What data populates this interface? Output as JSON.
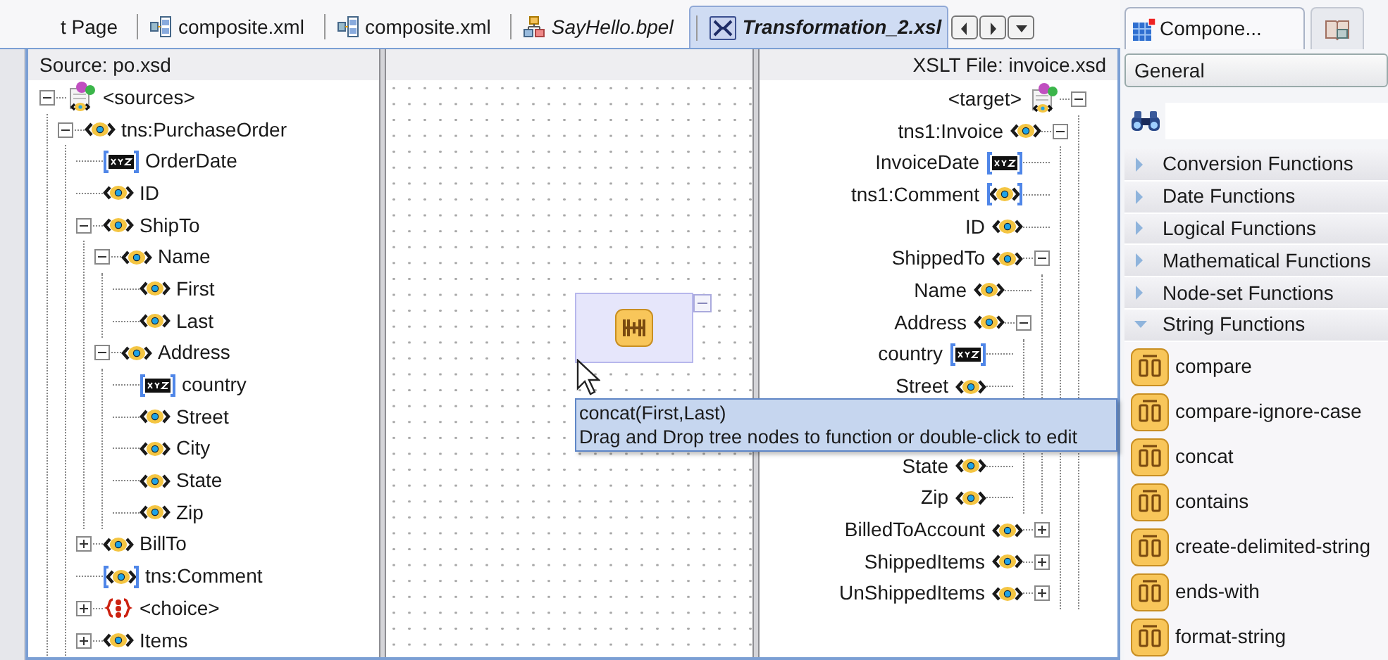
{
  "editor_tabs": [
    {
      "label": "t Page",
      "kind": "page",
      "italic": false,
      "selected": false
    },
    {
      "label": "composite.xml",
      "kind": "composite",
      "italic": false,
      "selected": false
    },
    {
      "label": "composite.xml",
      "kind": "composite",
      "italic": false,
      "selected": false
    },
    {
      "label": "SayHello.bpel",
      "kind": "bpel",
      "italic": true,
      "selected": false
    },
    {
      "label": "Transformation_2.xsl",
      "kind": "xsl",
      "italic": true,
      "selected": true
    }
  ],
  "source": {
    "title": "Source: po.xsd",
    "tree": [
      {
        "label": "<sources>",
        "kind": "root",
        "bracketed": false,
        "expanded": true,
        "children": [
          {
            "label": "tns:PurchaseOrder",
            "kind": "element",
            "bracketed": false,
            "expanded": true,
            "children": [
              {
                "label": "OrderDate",
                "kind": "text",
                "bracketed": true
              },
              {
                "label": "ID",
                "kind": "element",
                "bracketed": false
              },
              {
                "label": "ShipTo",
                "kind": "element",
                "bracketed": false,
                "expanded": true,
                "children": [
                  {
                    "label": "Name",
                    "kind": "element",
                    "bracketed": false,
                    "expanded": true,
                    "children": [
                      {
                        "label": "First",
                        "kind": "element",
                        "bracketed": false
                      },
                      {
                        "label": "Last",
                        "kind": "element",
                        "bracketed": false
                      }
                    ]
                  },
                  {
                    "label": "Address",
                    "kind": "element",
                    "bracketed": false,
                    "expanded": true,
                    "children": [
                      {
                        "label": "country",
                        "kind": "text",
                        "bracketed": true
                      },
                      {
                        "label": "Street",
                        "kind": "element",
                        "bracketed": false
                      },
                      {
                        "label": "City",
                        "kind": "element",
                        "bracketed": false
                      },
                      {
                        "label": "State",
                        "kind": "element",
                        "bracketed": false
                      },
                      {
                        "label": "Zip",
                        "kind": "element",
                        "bracketed": false
                      }
                    ]
                  }
                ]
              },
              {
                "label": "BillTo",
                "kind": "element",
                "bracketed": false,
                "expanded": false
              },
              {
                "label": "tns:Comment",
                "kind": "element",
                "bracketed": true
              },
              {
                "label": "<choice>",
                "kind": "choice",
                "bracketed": false,
                "expanded": false
              },
              {
                "label": "Items",
                "kind": "element",
                "bracketed": false,
                "expanded": false
              }
            ]
          }
        ]
      }
    ]
  },
  "target": {
    "title": "XSLT File: invoice.xsd",
    "tree": [
      {
        "label": "<target>",
        "kind": "root",
        "bracketed": false,
        "expanded": true,
        "children": [
          {
            "label": "tns1:Invoice",
            "kind": "element",
            "bracketed": false,
            "expanded": true,
            "children": [
              {
                "label": "InvoiceDate",
                "kind": "text",
                "bracketed": true
              },
              {
                "label": "tns1:Comment",
                "kind": "element",
                "bracketed": true
              },
              {
                "label": "ID",
                "kind": "element",
                "bracketed": false
              },
              {
                "label": "ShippedTo",
                "kind": "element",
                "bracketed": false,
                "expanded": true,
                "children": [
                  {
                    "label": "Name",
                    "kind": "element",
                    "bracketed": false
                  },
                  {
                    "label": "Address",
                    "kind": "element",
                    "bracketed": false,
                    "expanded": true,
                    "children": [
                      {
                        "label": "country",
                        "kind": "text",
                        "bracketed": true
                      },
                      {
                        "label": "Street",
                        "kind": "element",
                        "bracketed": false
                      },
                      {
                        "label": "State",
                        "kind": "element",
                        "bracketed": false
                      },
                      {
                        "label": "Zip",
                        "kind": "element",
                        "bracketed": false
                      }
                    ]
                  }
                ]
              },
              {
                "label": "BilledToAccount",
                "kind": "element",
                "bracketed": false,
                "expanded": false
              },
              {
                "label": "ShippedItems",
                "kind": "element",
                "bracketed": false,
                "expanded": false
              },
              {
                "label": "UnShippedItems",
                "kind": "element",
                "bracketed": false,
                "expanded": false
              }
            ]
          }
        ]
      }
    ]
  },
  "tooltip": {
    "title": "concat(First,Last)",
    "text": "Drag and Drop tree nodes to function or double-click to edit"
  },
  "palette": {
    "tabs": [
      {
        "label": "Compone...",
        "selected": true
      },
      {
        "selected": false
      }
    ],
    "dropdown": {
      "value": "General"
    },
    "categories": [
      {
        "label": "Conversion Functions",
        "expanded": false
      },
      {
        "label": "Date Functions",
        "expanded": false
      },
      {
        "label": "Logical Functions",
        "expanded": false
      },
      {
        "label": "Mathematical Functions",
        "expanded": false
      },
      {
        "label": "Node-set Functions",
        "expanded": false
      },
      {
        "label": "String Functions",
        "expanded": true,
        "items": [
          "compare",
          "compare-ignore-case",
          "concat",
          "contains",
          "create-delimited-string",
          "ends-with",
          "format-string"
        ]
      }
    ]
  }
}
